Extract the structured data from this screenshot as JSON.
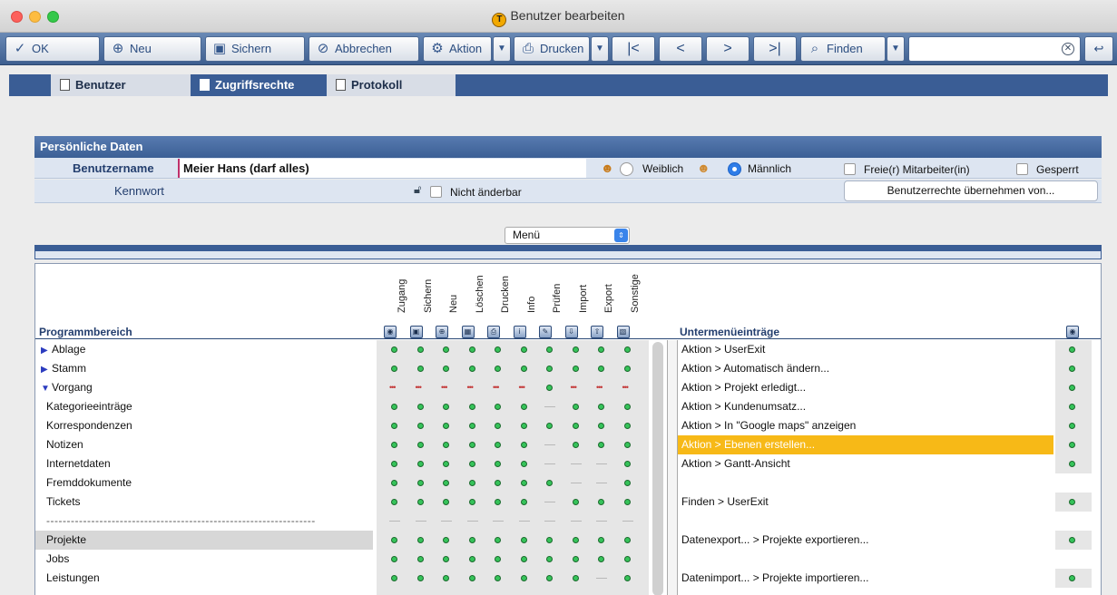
{
  "window": {
    "title": "Benutzer bearbeiten",
    "logo_letter": "T"
  },
  "toolbar": {
    "ok": "OK",
    "new": "Neu",
    "save": "Sichern",
    "cancel": "Abbrechen",
    "action": "Aktion",
    "print": "Drucken",
    "first": "|<",
    "prev": "<",
    "next": ">",
    "last": ">|",
    "find": "Finden",
    "search_value": ""
  },
  "tabs": [
    {
      "label": "Benutzer",
      "active": false
    },
    {
      "label": "Zugriffsrechte",
      "active": true
    },
    {
      "label": "Protokoll",
      "active": false
    }
  ],
  "personal": {
    "header": "Persönliche Daten",
    "username_label": "Benutzername",
    "username_value": "Meier Hans (darf alles)",
    "female_label": "Weiblich",
    "male_label": "Männlich",
    "gender_selected": "male",
    "freelancer_label": "Freie(r) Mitarbeiter(in)",
    "locked_label": "Gesperrt",
    "password_label": "Kennwort",
    "not_changeable_label": "Nicht änderbar",
    "copy_rights_button": "Benutzerrechte übernehmen von..."
  },
  "menu_select": {
    "value": "Menü"
  },
  "permissions": {
    "area_header": "Programmbereich",
    "submenu_header": "Untermenüeinträge",
    "columns": [
      "Zugang",
      "Sichern",
      "Neu",
      "Löschen",
      "Drucken",
      "Info",
      "Prüfen",
      "Import",
      "Export",
      "Sonstige"
    ],
    "rows": [
      {
        "label": "Ablage",
        "type": "closed",
        "cells": "GGGGGGGGGG"
      },
      {
        "label": "Stamm",
        "type": "closed",
        "cells": "GGGGGGGGGG"
      },
      {
        "label": "Vorgang",
        "type": "open",
        "cells": "RRRRRRGRRR"
      },
      {
        "label": "Kategorieeinträge",
        "type": "sub",
        "cells": "GGGGGG-GGG"
      },
      {
        "label": "Korrespondenzen",
        "type": "sub",
        "cells": "GGGGGGGGGG"
      },
      {
        "label": "Notizen",
        "type": "sub",
        "cells": "GGGGGG-GGG"
      },
      {
        "label": "Internetdaten",
        "type": "sub",
        "cells": "GGGGGG---G"
      },
      {
        "label": "Fremddokumente",
        "type": "sub",
        "cells": "GGGGGGG--G"
      },
      {
        "label": "Tickets",
        "type": "sub",
        "cells": "GGGGGG-GGG"
      },
      {
        "label": "------------------------------------------------------------------",
        "type": "dash",
        "cells": "----------"
      },
      {
        "label": "Projekte",
        "type": "sub",
        "cells": "GGGGGGGGGG",
        "selected": true
      },
      {
        "label": "Jobs",
        "type": "sub",
        "cells": "GGGGGGGGGG"
      },
      {
        "label": "Leistungen",
        "type": "sub",
        "cells": "GGGGGGGG-G"
      }
    ],
    "subitems": [
      {
        "label": "Aktion > UserExit",
        "dot": true
      },
      {
        "label": "Aktion > Automatisch ändern...",
        "dot": true
      },
      {
        "label": "Aktion > Projekt erledigt...",
        "dot": true
      },
      {
        "label": "Aktion > Kundenumsatz...",
        "dot": true
      },
      {
        "label": "Aktion > In \"Google maps\" anzeigen",
        "dot": true
      },
      {
        "label": "Aktion > Ebenen erstellen...",
        "dot": true,
        "selected": true
      },
      {
        "label": "Aktion > Gantt-Ansicht",
        "dot": true
      },
      {
        "label": "",
        "dot": false
      },
      {
        "label": "Finden > UserExit",
        "dot": true
      },
      {
        "label": "",
        "dot": false
      },
      {
        "label": "Datenexport... > Projekte exportieren...",
        "dot": true
      },
      {
        "label": "",
        "dot": false
      },
      {
        "label": "Datenimport... > Projekte importieren...",
        "dot": true
      }
    ]
  },
  "colors": {
    "accent": "#3a5d95",
    "selection": "#f7b917",
    "ok_dot": "#36c35a",
    "warn_dots": "#c43a3a"
  }
}
